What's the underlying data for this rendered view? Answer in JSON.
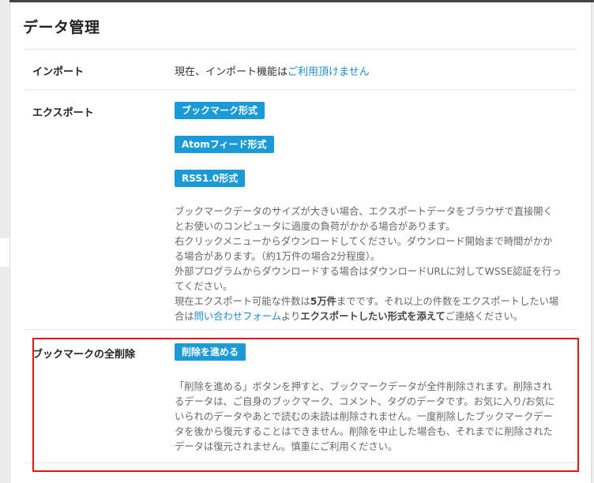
{
  "section": {
    "title": "データ管理"
  },
  "import": {
    "label": "インポート",
    "text": "現在、インポート機能は",
    "link": "ご利用頂けません"
  },
  "export": {
    "label": "エクスポート",
    "buttons": [
      "ブックマーク形式",
      "Atomフィード形式",
      "RSS1.0形式"
    ],
    "description": {
      "line1": "ブックマークデータのサイズが大きい場合、エクスポートデータをブラウザで直接開くとお使いのコンピュータに過度の負荷がかかる場合があります。",
      "line2": "右クリックメニューからダウンロードしてください。ダウンロード開始まで時間がかかる場合があります。（約1万件の場合2分程度）。",
      "line3": "外部プログラムからダウンロードする場合はダウンロードURLに対してWSSE認証を行ってください。",
      "line4_pre": "現在エクスポート可能な件数は",
      "line4_bold": "5万件",
      "line4_mid": "までです。それ以上の件数をエクスポートしたい場合は",
      "line4_link": "問い合わせフォーム",
      "line4_mid2": "より",
      "line4_bold2": "エクスポートしたい形式を添えて",
      "line4_post": "ご連絡ください。"
    }
  },
  "delete": {
    "label": "ブックマークの全削除",
    "button": "削除を進める",
    "description": "「削除を進める」ボタンを押すと、ブックマークデータが全件削除されます。削除されるデータは、ご自身のブックマーク、コメント、タグのデータです。お気に入り/お気にいられのデータやあとで読むの未読は削除されません。一度削除したブックマークデータを後から復元することはできません。削除を中止した場合も、それまでに削除されたデータは復元されません。慎重にご利用ください。"
  },
  "colors": {
    "accent": "#1a9ad6",
    "link": "#1a8ccf",
    "highlight_border": "#e01818"
  }
}
